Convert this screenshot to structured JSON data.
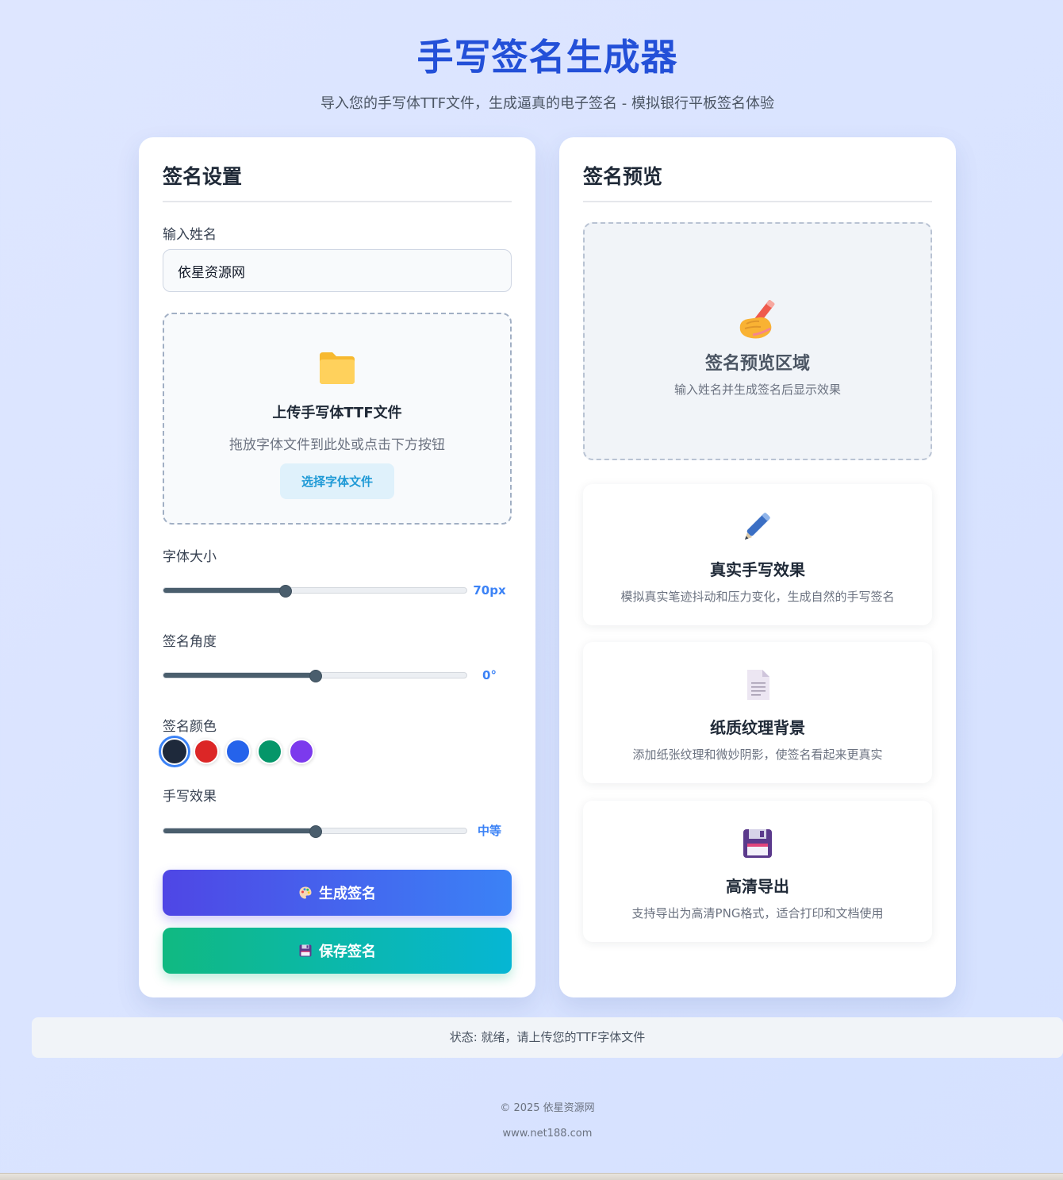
{
  "header": {
    "title": "手写签名生成器",
    "subtitle": "导入您的手写体TTF文件，生成逼真的电子签名 - 模拟银行平板签名体验"
  },
  "settings": {
    "title": "签名设置",
    "name_label": "输入姓名",
    "name_value": "依星资源网",
    "upload": {
      "icon": "folder-icon",
      "title": "上传手写体TTF文件",
      "hint": "拖放字体文件到此处或点击下方按钮",
      "button": "选择字体文件"
    },
    "font_size": {
      "label": "字体大小",
      "value_text": "70px",
      "fraction": 0.4
    },
    "angle": {
      "label": "签名角度",
      "value_text": "0°",
      "fraction": 0.5
    },
    "color": {
      "label": "签名颜色",
      "options": [
        "#1e293b",
        "#dc2626",
        "#2563eb",
        "#059669",
        "#7c3aed"
      ],
      "selected_index": 0
    },
    "effect": {
      "label": "手写效果",
      "value_text": "中等",
      "fraction": 0.5
    },
    "generate_label": "生成签名",
    "generate_icon": "palette-icon",
    "save_label": "保存签名",
    "save_icon": "floppy-disk-icon"
  },
  "preview": {
    "title": "签名预览",
    "area": {
      "icon": "writing-hand-icon",
      "title": "签名预览区域",
      "hint": "输入姓名并生成签名后显示效果"
    },
    "features": [
      {
        "icon": "pen-icon",
        "title": "真实手写效果",
        "desc": "模拟真实笔迹抖动和压力变化，生成自然的手写签名"
      },
      {
        "icon": "document-icon",
        "title": "纸质纹理背景",
        "desc": "添加纸张纹理和微妙阴影，使签名看起来更真实"
      },
      {
        "icon": "floppy-disk-icon",
        "title": "高清导出",
        "desc": "支持导出为高清PNG格式，适合打印和文档使用"
      }
    ]
  },
  "status": {
    "text": "状态: 就绪，请上传您的TTF字体文件"
  },
  "footer": {
    "copyright": "© 2025 依星资源网",
    "url": "www.net188.com"
  },
  "colors": {
    "accent": "#2350d8",
    "slider_value": "#3b82f6",
    "generate_gradient": [
      "#4f46e5",
      "#3b82f6"
    ],
    "save_gradient": [
      "#10b981",
      "#06b6d4"
    ]
  }
}
